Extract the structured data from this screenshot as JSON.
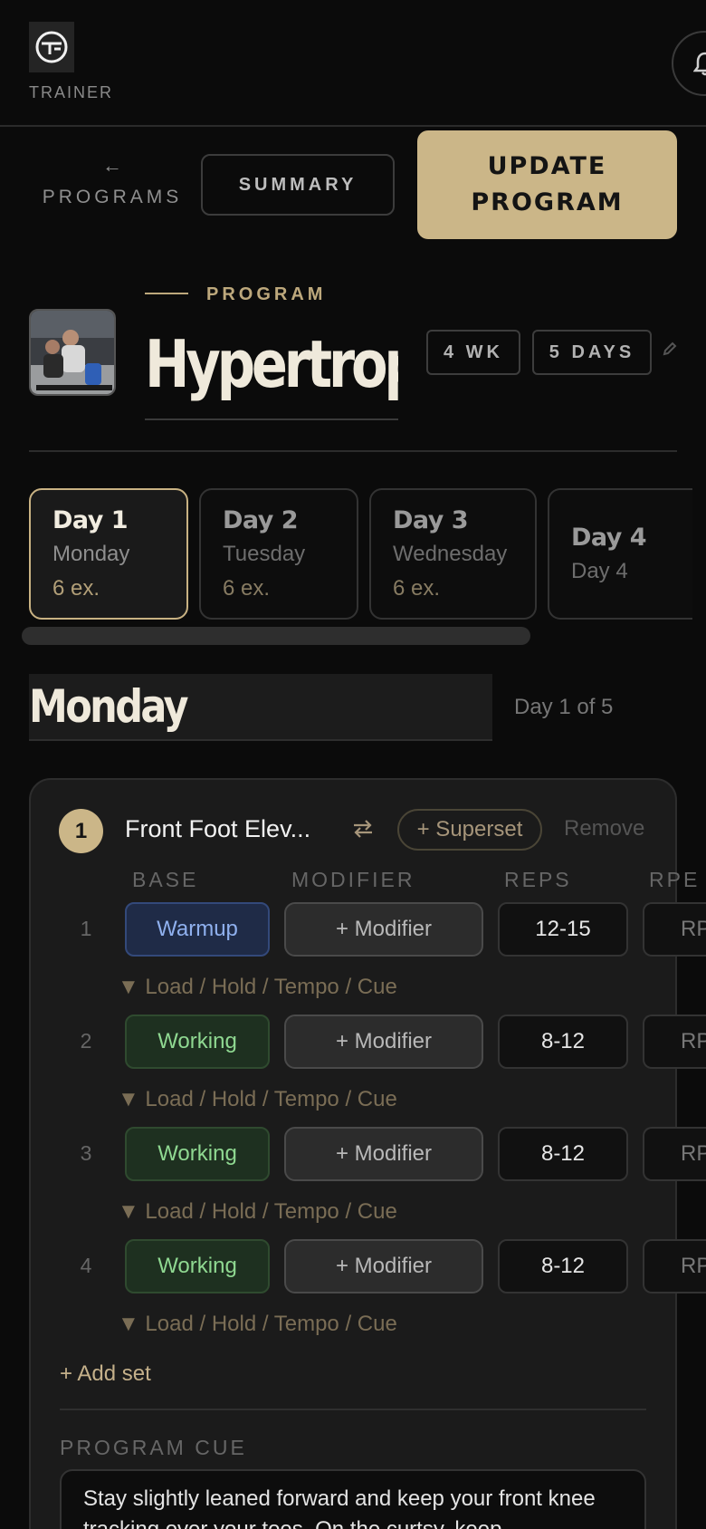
{
  "header": {
    "role_label": "TRAINER",
    "logo_icon": "logo-icon",
    "notification_icon": "bell-icon"
  },
  "nav": {
    "back_arrow": "←",
    "back_label": "PROGRAMS",
    "summary_label": "SUMMARY",
    "update_label": "UPDATE\nPROGRAM"
  },
  "program": {
    "eyebrow": "PROGRAM",
    "title": "Hypertrophy",
    "weeks_chip": "4 WK",
    "days_chip": "5 DAYS",
    "edit_icon": "pencil-icon"
  },
  "days": [
    {
      "name": "Day 1",
      "weekday": "Monday",
      "count": "6 ex.",
      "active": true
    },
    {
      "name": "Day 2",
      "weekday": "Tuesday",
      "count": "6 ex.",
      "active": false
    },
    {
      "name": "Day 3",
      "weekday": "Wednesday",
      "count": "6 ex.",
      "active": false
    },
    {
      "name": "Day 4",
      "weekday": "Day 4",
      "count": "",
      "active": false
    }
  ],
  "day_header": {
    "title": "Monday",
    "counter": "Day 1 of 5"
  },
  "exercise": {
    "index": "1",
    "name": "Front Foot Elev...",
    "swap_icon": "swap-arrows-icon",
    "superset_label": "+ Superset",
    "remove_label": "Remove",
    "columns": {
      "base": "BASE",
      "modifier": "MODIFIER",
      "reps": "REPS",
      "rpe": "RPE"
    },
    "sets": [
      {
        "num": "1",
        "base": "Warmup",
        "modifier": "+ Modifier",
        "reps": "12-15",
        "rpe": "RPE",
        "details": "▼ Load / Hold / Tempo / Cue"
      },
      {
        "num": "2",
        "base": "Working",
        "modifier": "+ Modifier",
        "reps": "8-12",
        "rpe": "RPE",
        "details": "▼ Load / Hold / Tempo / Cue"
      },
      {
        "num": "3",
        "base": "Working",
        "modifier": "+ Modifier",
        "reps": "8-12",
        "rpe": "RPE",
        "details": "▼ Load / Hold / Tempo / Cue"
      },
      {
        "num": "4",
        "base": "Working",
        "modifier": "+ Modifier",
        "reps": "8-12",
        "rpe": "RPE",
        "details": "▼ Load / Hold / Tempo / Cue"
      }
    ],
    "add_set_label": "+ Add set",
    "cue_label": "PROGRAM CUE",
    "cue_text": "Stay slightly leaned forward and keep your front knee tracking over your toes. On the curtsy, keep"
  },
  "colors": {
    "accent_gold": "#cbb688",
    "warmup_blue": "#8fb0ee",
    "working_green": "#8fd891",
    "background": "#0b0b0b"
  }
}
